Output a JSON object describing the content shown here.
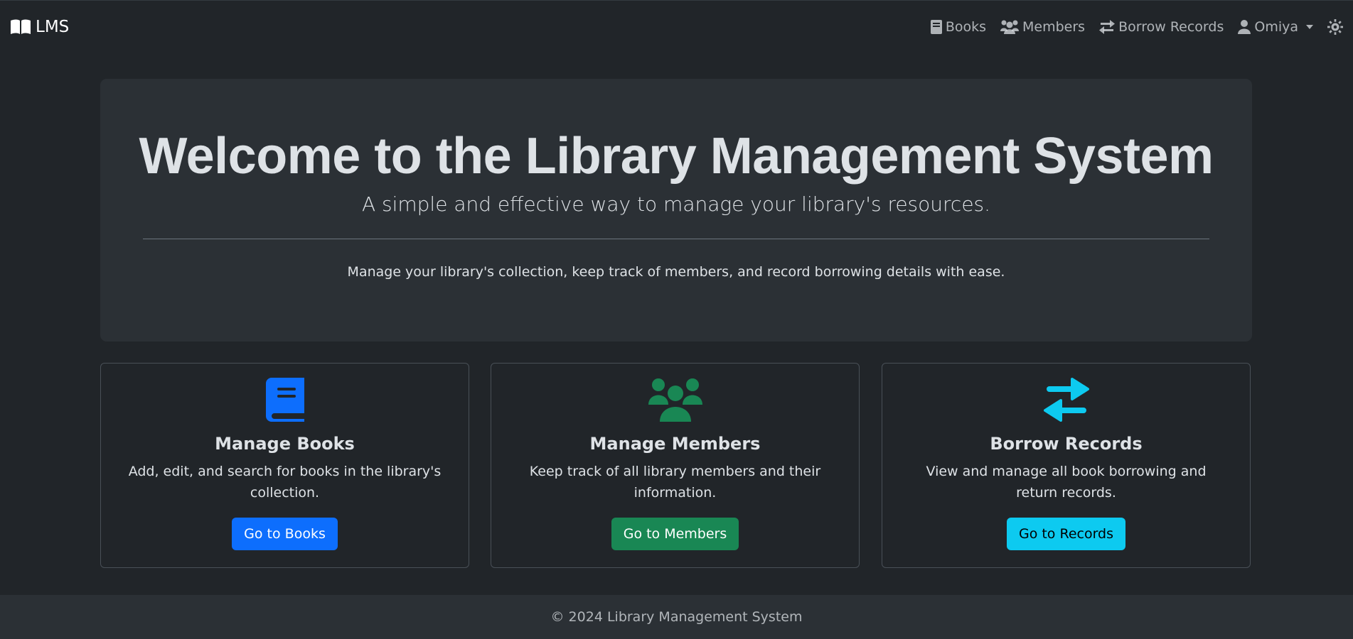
{
  "navbar": {
    "brand": "LMS",
    "links": [
      {
        "label": "Books",
        "icon": "book-icon"
      },
      {
        "label": "Members",
        "icon": "users-icon"
      },
      {
        "label": "Borrow Records",
        "icon": "exchange-icon"
      }
    ],
    "user": "Omiya",
    "theme_icon": "sun-icon"
  },
  "hero": {
    "title": "Welcome to the Library Management System",
    "lead": "A simple and effective way to manage your library's resources.",
    "description": "Manage your library's collection, keep track of members, and record borrowing details with ease."
  },
  "cards": [
    {
      "title": "Manage Books",
      "text": "Add, edit, and search for books in the library's collection.",
      "button": "Go to Books",
      "icon": "book-icon",
      "color": "#0d6efd"
    },
    {
      "title": "Manage Members",
      "text": "Keep track of all library members and their information.",
      "button": "Go to Members",
      "icon": "users-icon",
      "color": "#198754"
    },
    {
      "title": "Borrow Records",
      "text": "View and manage all book borrowing and return records.",
      "button": "Go to Records",
      "icon": "exchange-icon",
      "color": "#0dcaf0"
    }
  ],
  "footer": {
    "text": "© 2024 Library Management System"
  }
}
